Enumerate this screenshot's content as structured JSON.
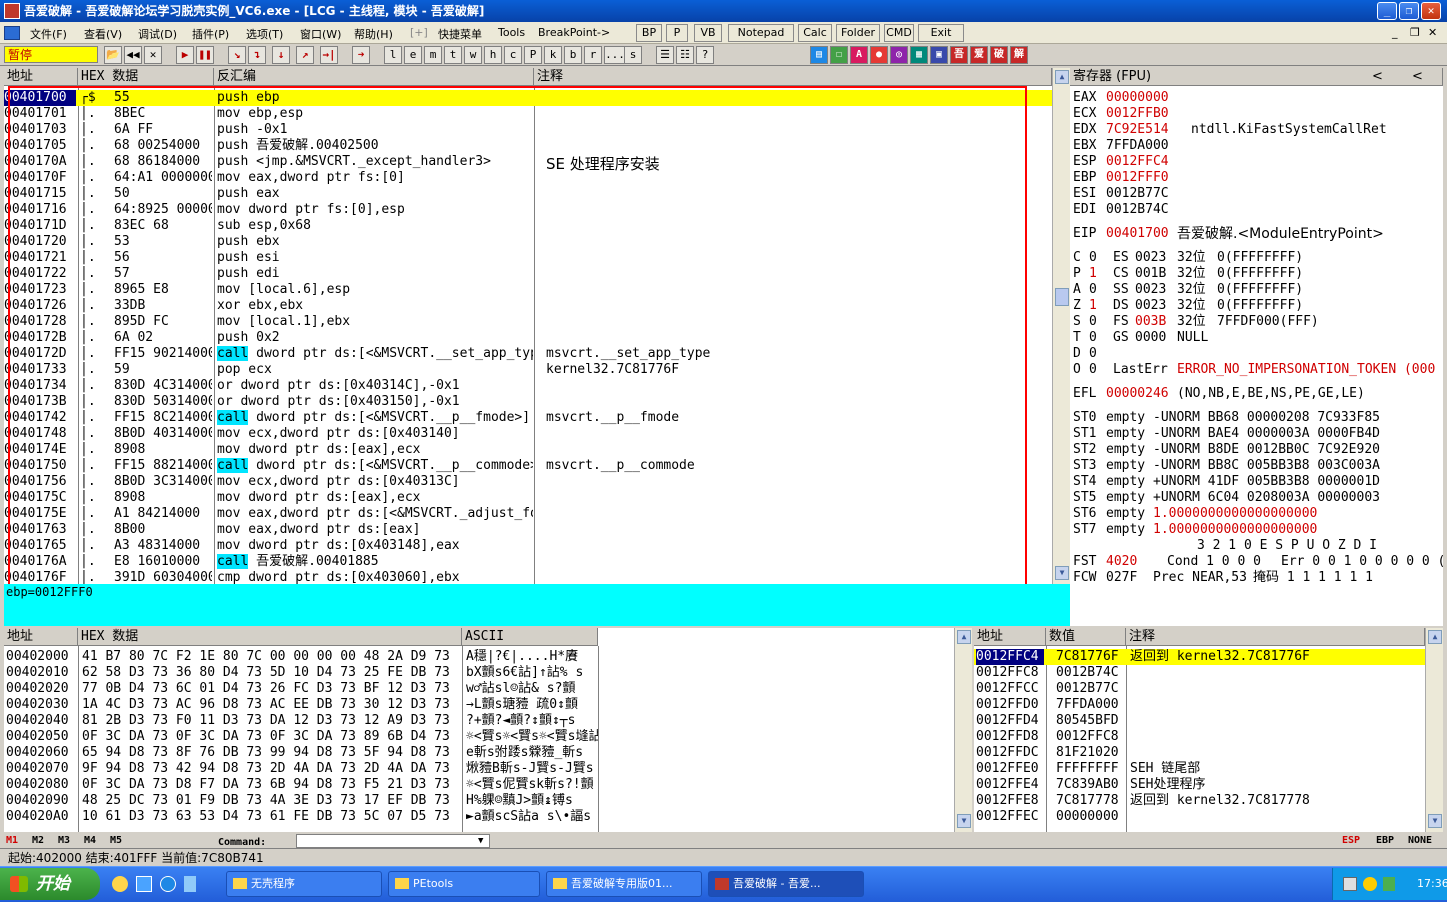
{
  "title": "吾爱破解 - 吾爱破解论坛学习脱壳实例_VC6.exe - [LCG - 主线程, 模块 - 吾爱破解]",
  "window_buttons": [
    "_",
    "❐",
    "✕"
  ],
  "menu": {
    "items": [
      "文件(F)",
      "查看(V)",
      "调试(D)",
      "插件(P)",
      "选项(T)",
      "窗口(W)",
      "帮助(H)",
      "[+]",
      "快捷菜单",
      "Tools",
      "BreakPoint->"
    ],
    "buttons": [
      "BP",
      "P",
      "VB",
      "Notepad",
      "Calc",
      "Folder",
      "CMD",
      "Exit"
    ],
    "mdi_controls": [
      "_",
      "❐",
      "✕"
    ]
  },
  "toolbar": {
    "status": "暂停",
    "buttons": [
      "📂",
      "◀◀",
      "✕",
      "▶",
      "❚❚",
      "↘",
      "↴",
      "↓",
      "↗",
      "→|",
      "➜",
      "l",
      "e",
      "m",
      "t",
      "w",
      "h",
      "c",
      "P",
      "k",
      "b",
      "r",
      "...",
      "s",
      "☰",
      "☷",
      "?"
    ],
    "plugin_buttons": [
      "▤",
      "☐",
      "A",
      "●",
      "◎",
      "▦",
      "▣",
      "吾",
      "爱",
      "破",
      "解"
    ]
  },
  "disasm": {
    "headers": [
      "地址",
      "HEX 数据",
      "反汇编",
      "注释"
    ],
    "rows": [
      {
        "addr": "00401700",
        "mark": "┌$",
        "hex": "55",
        "asm": "push ebp",
        "comment": "",
        "selected": true
      },
      {
        "addr": "00401701",
        "mark": "│.",
        "hex": "8BEC",
        "asm": "mov ebp,esp",
        "comment": ""
      },
      {
        "addr": "00401703",
        "mark": "│.",
        "hex": "6A FF",
        "asm": "push -0x1",
        "comment": ""
      },
      {
        "addr": "00401705",
        "mark": "│.",
        "hex": "68 00254000",
        "asm": "push 吾爱破解.00402500",
        "comment": ""
      },
      {
        "addr": "0040170A",
        "mark": "│.",
        "hex": "68 86184000",
        "asm": "push <jmp.&MSVCRT._except_handler3>",
        "comment": "SE 处理程序安装",
        "big_comment": true
      },
      {
        "addr": "0040170F",
        "mark": "│.",
        "hex": "64:A1 00000000",
        "asm": "mov eax,dword ptr fs:[0]",
        "comment": ""
      },
      {
        "addr": "00401715",
        "mark": "│.",
        "hex": "50",
        "asm": "push eax",
        "comment": ""
      },
      {
        "addr": "00401716",
        "mark": "│.",
        "hex": "64:8925 00000000",
        "asm": "mov dword ptr fs:[0],esp",
        "comment": ""
      },
      {
        "addr": "0040171D",
        "mark": "│.",
        "hex": "83EC 68",
        "asm": "sub esp,0x68",
        "comment": ""
      },
      {
        "addr": "00401720",
        "mark": "│.",
        "hex": "53",
        "asm": "push ebx",
        "comment": ""
      },
      {
        "addr": "00401721",
        "mark": "│.",
        "hex": "56",
        "asm": "push esi",
        "comment": ""
      },
      {
        "addr": "00401722",
        "mark": "│.",
        "hex": "57",
        "asm": "push edi",
        "comment": ""
      },
      {
        "addr": "00401723",
        "mark": "│.",
        "hex": "8965 E8",
        "asm": "mov [local.6],esp",
        "comment": ""
      },
      {
        "addr": "00401726",
        "mark": "│.",
        "hex": "33DB",
        "asm": "xor ebx,ebx",
        "comment": ""
      },
      {
        "addr": "00401728",
        "mark": "│.",
        "hex": "895D FC",
        "asm": "mov [local.1],ebx",
        "comment": ""
      },
      {
        "addr": "0040172B",
        "mark": "│.",
        "hex": "6A 02",
        "asm": "push 0x2",
        "comment": ""
      },
      {
        "addr": "0040172D",
        "mark": "│.",
        "hex": "FF15 90214000",
        "asm_call": "call",
        "asm": " dword ptr ds:[<&MSVCRT.__set_app_type>]",
        "comment": "msvcrt.__set_app_type"
      },
      {
        "addr": "00401733",
        "mark": "│.",
        "hex": "59",
        "asm": "pop ecx",
        "comment": "kernel32.7C81776F"
      },
      {
        "addr": "00401734",
        "mark": "│.",
        "hex": "830D 4C314000 FF",
        "asm": "or dword ptr ds:[0x40314C],-0x1",
        "comment": ""
      },
      {
        "addr": "0040173B",
        "mark": "│.",
        "hex": "830D 50314000 FF",
        "asm": "or dword ptr ds:[0x403150],-0x1",
        "comment": ""
      },
      {
        "addr": "00401742",
        "mark": "│.",
        "hex": "FF15 8C214000",
        "asm_call": "call",
        "asm": " dword ptr ds:[<&MSVCRT.__p__fmode>]",
        "comment": "msvcrt.__p__fmode"
      },
      {
        "addr": "00401748",
        "mark": "│.",
        "hex": "8B0D 40314000",
        "asm": "mov ecx,dword ptr ds:[0x403140]",
        "comment": ""
      },
      {
        "addr": "0040174E",
        "mark": "│.",
        "hex": "8908",
        "asm": "mov dword ptr ds:[eax],ecx",
        "comment": ""
      },
      {
        "addr": "00401750",
        "mark": "│.",
        "hex": "FF15 88214000",
        "asm_call": "call",
        "asm": " dword ptr ds:[<&MSVCRT.__p__commode>]",
        "comment": "msvcrt.__p__commode"
      },
      {
        "addr": "00401756",
        "mark": "│.",
        "hex": "8B0D 3C314000",
        "asm": "mov ecx,dword ptr ds:[0x40313C]",
        "comment": ""
      },
      {
        "addr": "0040175C",
        "mark": "│.",
        "hex": "8908",
        "asm": "mov dword ptr ds:[eax],ecx",
        "comment": ""
      },
      {
        "addr": "0040175E",
        "mark": "│.",
        "hex": "A1 84214000",
        "asm": "mov eax,dword ptr ds:[<&MSVCRT._adjust_fdiv>]",
        "comment": ""
      },
      {
        "addr": "00401763",
        "mark": "│.",
        "hex": "8B00",
        "asm": "mov eax,dword ptr ds:[eax]",
        "comment": ""
      },
      {
        "addr": "00401765",
        "mark": "│.",
        "hex": "A3 48314000",
        "asm": "mov dword ptr ds:[0x403148],eax",
        "comment": ""
      },
      {
        "addr": "0040176A",
        "mark": "│.",
        "hex": "E8 16010000",
        "asm_call": "call",
        "asm": " 吾爱破解.00401885",
        "comment": ""
      },
      {
        "addr": "0040176F",
        "mark": "│.",
        "hex": "391D 60304000",
        "asm": "cmp dword ptr ds:[0x403060],ebx",
        "comment": ""
      }
    ]
  },
  "info_text": "ebp=0012FFF0",
  "registers": {
    "header": "寄存器 (FPU)",
    "header_arrows": [
      "<",
      "<"
    ],
    "gp": [
      {
        "name": "EAX",
        "val": "00000000",
        "extra": "",
        "red": true
      },
      {
        "name": "ECX",
        "val": "0012FFB0",
        "extra": "",
        "red": true
      },
      {
        "name": "EDX",
        "val": "7C92E514",
        "extra": "ntdll.KiFastSystemCallRet",
        "red": true
      },
      {
        "name": "EBX",
        "val": "7FFDA000",
        "extra": "",
        "red": false
      },
      {
        "name": "ESP",
        "val": "0012FFC4",
        "extra": "",
        "red": true
      },
      {
        "name": "EBP",
        "val": "0012FFF0",
        "extra": "",
        "red": true
      },
      {
        "name": "ESI",
        "val": "0012B77C",
        "extra": "",
        "red": false
      },
      {
        "name": "EDI",
        "val": "0012B74C",
        "extra": "",
        "red": false
      }
    ],
    "eip": {
      "name": "EIP",
      "val": "00401700",
      "extra": "吾爱破解.<ModuleEntryPoint>"
    },
    "flags": [
      {
        "f": "C",
        "v": "0",
        "seg": "ES",
        "sv": "0023",
        "bits": "32位",
        "base": "0(FFFFFFFF)",
        "red": false
      },
      {
        "f": "P",
        "v": "1",
        "seg": "CS",
        "sv": "001B",
        "bits": "32位",
        "base": "0(FFFFFFFF)",
        "red": true
      },
      {
        "f": "A",
        "v": "0",
        "seg": "SS",
        "sv": "0023",
        "bits": "32位",
        "base": "0(FFFFFFFF)",
        "red": false
      },
      {
        "f": "Z",
        "v": "1",
        "seg": "DS",
        "sv": "0023",
        "bits": "32位",
        "base": "0(FFFFFFFF)",
        "red": true
      },
      {
        "f": "S",
        "v": "0",
        "seg": "FS",
        "sv": "003B",
        "bits": "32位",
        "base": "7FFDF000(FFF)",
        "red": false,
        "svred": true
      },
      {
        "f": "T",
        "v": "0",
        "seg": "GS",
        "sv": "0000",
        "bits": "NULL",
        "base": "",
        "red": false
      },
      {
        "f": "D",
        "v": "0",
        "seg": "",
        "sv": "",
        "bits": "",
        "base": "",
        "red": false
      },
      {
        "f": "O",
        "v": "0",
        "seg": "LastErr",
        "sv": "ERROR_NO_IMPERSONATION_TOKEN (000",
        "bits": "",
        "base": "",
        "red": false,
        "lasterr": true
      }
    ],
    "efl": {
      "name": "EFL",
      "val": "00000246",
      "extra": "(NO,NB,E,BE,NS,PE,GE,LE)"
    },
    "fpu": [
      {
        "n": "ST0",
        "t": "empty",
        "v": "-UNORM BB68 00000208 7C933F85"
      },
      {
        "n": "ST1",
        "t": "empty",
        "v": "-UNORM BAE4 0000003A 0000FB4D"
      },
      {
        "n": "ST2",
        "t": "empty",
        "v": "-UNORM B8DE 0012BB0C 7C92E920"
      },
      {
        "n": "ST3",
        "t": "empty",
        "v": "-UNORM BB8C 005BB3B8 003C003A"
      },
      {
        "n": "ST4",
        "t": "empty",
        "v": "+UNORM 41DF 005BB3B8 0000001D"
      },
      {
        "n": "ST5",
        "t": "empty",
        "v": "+UNORM 6C04 0208003A 00000003"
      },
      {
        "n": "ST6",
        "t": "empty",
        "v": "1.0000000000000000000",
        "red": true
      },
      {
        "n": "ST7",
        "t": "empty",
        "v": "1.0000000000000000000",
        "red": true
      }
    ],
    "fst_header": "3 2 1 0      E S P U O Z D I",
    "fst": {
      "name": "FST",
      "val": "4020",
      "rest1": "Cond 1 0 0 0",
      "rest2": "Err 0 0 1 0 0 0 0 0  ("
    },
    "fcw": {
      "name": "FCW",
      "val": "027F",
      "rest1": "Prec NEAR,53",
      "rest2": "掩码    1 1 1 1 1 1"
    }
  },
  "dump": {
    "headers": [
      "地址",
      "HEX 数据",
      "ASCII"
    ],
    "rows": [
      {
        "addr": "00402000",
        "hex": "41 B7 80 7C F2 1E 80 7C 00 00 00 00 48 2A D9 73",
        "ascii": "A穩|?€|....H*賡"
      },
      {
        "addr": "00402010",
        "hex": "62 58 D3 73 36 80 D4 73 5D 10 D4 73 25 FE DB 73",
        "ascii": "bX顫s6€詀]↑詀%  s"
      },
      {
        "addr": "00402020",
        "hex": "77 0B D4 73 6C 01 D4 73 26 FC D3 73 BF 12 D3 73",
        "ascii": "w♂詀sl☺詀&  s?顫"
      },
      {
        "addr": "00402030",
        "hex": "1A 4C D3 73 AC 96 D8 73 AC EE DB 73 30 12 D3 73",
        "ascii": "→L顫s瑭豷 疏0↕顫"
      },
      {
        "addr": "00402040",
        "hex": "81 2B D3 73 F0 11 D3 73 DA 12 D3 73 12 A9 D3 73",
        "ascii": "?+顫?◄顫?↕顫↕┬s"
      },
      {
        "addr": "00402050",
        "hex": "0F 3C DA 73 0F 3C DA 73 0F 3C DA 73 89 6B D4 73",
        "ascii": "☼<贒s☼<贒s☼<贒s塳詀"
      },
      {
        "addr": "00402060",
        "hex": "65 94 D8 73 8F 76 DB 73 99 94 D8 73 5F 94 D8 73",
        "ascii": "e斬s弣踒s檾豷_斬s"
      },
      {
        "addr": "00402070",
        "hex": "9F 94 D8 73 42 94 D8 73 2D 4A DA 73 2D 4A DA 73",
        "ascii": "煍豷B斬s-J贒s-J贒s"
      },
      {
        "addr": "00402080",
        "hex": "0F 3C DA 73 D8 F7 DA 73 6B 94 D8 73 F5 21 D3 73",
        "ascii": "☼<贒s伲贒sk斬s?!顫"
      },
      {
        "addr": "00402090",
        "hex": "48 25 DC 73 01 F9 DB 73 4A 3E D3 73 17 EF DB 73",
        "ascii": "H%躶☺黰J>顫↨镈s"
      },
      {
        "addr": "004020A0",
        "hex": "10 61 D3 73 63 53 D4 73 61 FE DB 73 5C 07 D5 73",
        "ascii": "►a顫scS詀a  s\\•諨s"
      }
    ]
  },
  "stack": {
    "headers": [
      "地址",
      "数值",
      "注释"
    ],
    "rows": [
      {
        "addr": "0012FFC4",
        "val": "7C81776F",
        "comment": "返回到 kernel32.7C81776F",
        "selected": true
      },
      {
        "addr": "0012FFC8",
        "val": "0012B74C",
        "comment": ""
      },
      {
        "addr": "0012FFCC",
        "val": "0012B77C",
        "comment": ""
      },
      {
        "addr": "0012FFD0",
        "val": "7FFDA000",
        "comment": ""
      },
      {
        "addr": "0012FFD4",
        "val": "80545BFD",
        "comment": ""
      },
      {
        "addr": "0012FFD8",
        "val": "0012FFC8",
        "comment": ""
      },
      {
        "addr": "0012FFDC",
        "val": "81F21020",
        "comment": ""
      },
      {
        "addr": "0012FFE0",
        "val": "FFFFFFFF",
        "comment": "SEH 链尾部"
      },
      {
        "addr": "0012FFE4",
        "val": "7C839AB0",
        "comment": "SEH处理程序"
      },
      {
        "addr": "0012FFE8",
        "val": "7C817778",
        "comment": "返回到 kernel32.7C817778"
      },
      {
        "addr": "0012FFEC",
        "val": "00000000",
        "comment": ""
      }
    ]
  },
  "cmdbar": {
    "tabs": [
      "M1",
      "M2",
      "M3",
      "M4",
      "M5"
    ],
    "label": "Command:",
    "right": [
      "ESP",
      "EBP",
      "NONE"
    ]
  },
  "status": "起始:402000 结束:401FFF 当前值:7C80B741",
  "taskbar": {
    "start": "开始",
    "tasks": [
      "无壳程序",
      "PEtools",
      "吾爱破解专用版01...",
      "吾爱破解 - 吾爱..."
    ],
    "clock": "17:36"
  },
  "colors": {
    "accent_red": "#d00000",
    "selection": "#ffff00",
    "call_highlight": "#00e5ff",
    "annotation_box": "#ff0000"
  }
}
